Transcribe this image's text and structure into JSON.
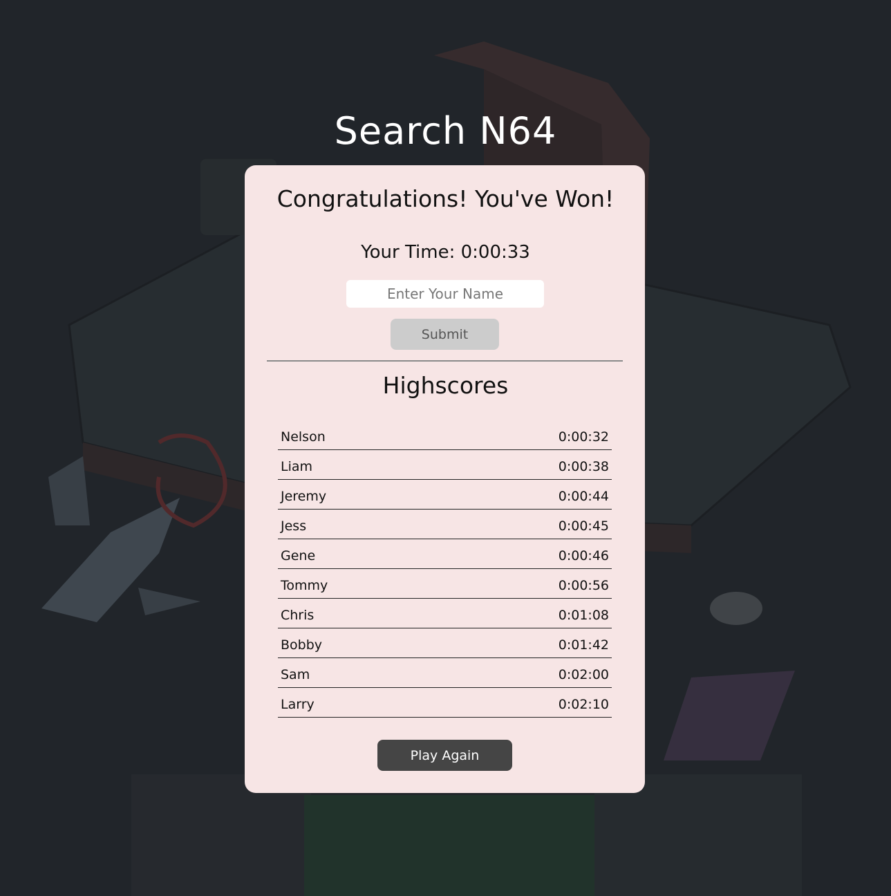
{
  "title": "Search N64",
  "result": {
    "heading": "Congratulations! You've Won!",
    "your_time": "Your Time: 0:00:33"
  },
  "name_form": {
    "placeholder": "Enter Your Name",
    "value": "",
    "submit_label": "Submit"
  },
  "highscores": {
    "title": "Highscores",
    "rows": [
      {
        "name": "Nelson",
        "time": "0:00:32"
      },
      {
        "name": "Liam",
        "time": "0:00:38"
      },
      {
        "name": "Jeremy",
        "time": "0:00:44"
      },
      {
        "name": "Jess",
        "time": "0:00:45"
      },
      {
        "name": "Gene",
        "time": "0:00:46"
      },
      {
        "name": "Tommy",
        "time": "0:00:56"
      },
      {
        "name": "Chris",
        "time": "0:01:08"
      },
      {
        "name": "Bobby",
        "time": "0:01:42"
      },
      {
        "name": "Sam",
        "time": "0:02:00"
      },
      {
        "name": "Larry",
        "time": "0:02:10"
      }
    ]
  },
  "play_again_label": "Play Again",
  "colors": {
    "background": "#23272c",
    "panel": "#f7e5e5",
    "submit_button": "#cccccc",
    "play_again_button": "#454545"
  },
  "background_art": "n64-console-illustration"
}
